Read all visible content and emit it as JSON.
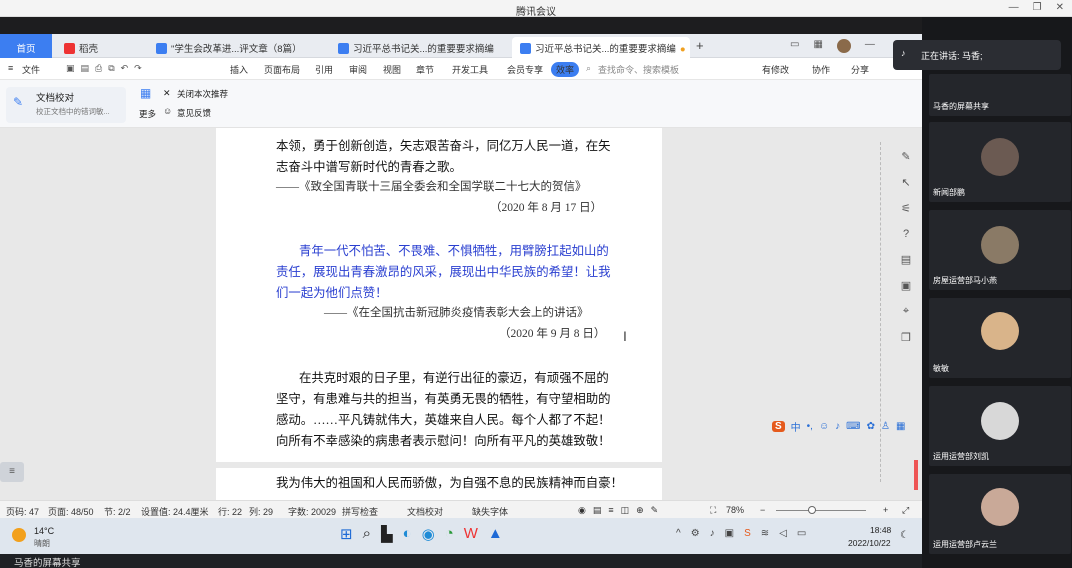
{
  "window": {
    "title": "腾讯会议"
  },
  "tabs": [
    {
      "label": "首页"
    },
    {
      "label": "稻壳"
    },
    {
      "label": "\"学生会改革进...评文章（8篇）"
    },
    {
      "label": "习近平总书记关...的重要要求摘编"
    },
    {
      "label": "习近平总书记关...的重要要求摘编"
    }
  ],
  "menu": {
    "file": "文件",
    "items": [
      "插入",
      "页面布局",
      "引用",
      "审阅",
      "视图",
      "章节",
      "开发工具",
      "会员专享"
    ],
    "active_pill": "效率",
    "search_placeholder": "查找命令、搜索模板",
    "revisions": "有修改",
    "collab": "协作",
    "share": "分享"
  },
  "ribbon": {
    "proof_title": "文档校对",
    "proof_sub": "校正文档中的错词敏...",
    "more": "更多",
    "close_recommend": "关闭本次推荐",
    "feedback": "意见反馈"
  },
  "document": {
    "p1_l1": "本领，勇于创新创造，矢志艰苦奋斗，同亿万人民一道，在矢",
    "p1_l2": "志奋斗中谱写新时代的青春之歌。",
    "p1_src": "——《致全国青联十三届全委会和全国学联二十七大的贺信》",
    "p1_date": "（2020 年 8 月 17 日）",
    "p2_l1": "青年一代不怕苦、不畏难、不惧牺牲，用臂膀扛起如山的",
    "p2_l2": "责任，展现出青春激昂的风采，展现出中华民族的希望！让我",
    "p2_l3": "们一起为他们点赞！",
    "p2_src": "——《在全国抗击新冠肺炎疫情表彰大会上的讲话》",
    "p2_date": "（2020 年 9 月 8 日）",
    "p3_l1": "在共克时艰的日子里，有逆行出征的豪迈，有顽强不屈的",
    "p3_l2": "坚守，有患难与共的担当，有英勇无畏的牺牲，有守望相助的",
    "p3_l3": "感动。……平凡铸就伟大，英雄来自人民。每个人都了不起！",
    "p3_l4": "向所有不幸感染的病患者表示慰问！向所有平凡的英雄致敬！",
    "p4_l1": "我为伟大的祖国和人民而骄傲，为自强不息的民族精神而自豪！"
  },
  "ime": {
    "lang": "中"
  },
  "status": {
    "page": "页码: 47",
    "pages": "页面: 48/50",
    "section": "节: 2/2",
    "setting": "设置值: 24.4厘米",
    "row": "行: 22",
    "col": "列: 29",
    "words": "字数: 20029",
    "spell": "拼写检查",
    "proof": "文档校对",
    "font_missing": "缺失字体",
    "zoom": "78%"
  },
  "taskbar": {
    "temp": "14°C",
    "weather": "晴朗",
    "time": "18:48",
    "date": "2022/10/22"
  },
  "share_banner": "马香的屏幕共享",
  "meeting": {
    "speaking": "正在讲话: 马香;",
    "participants": [
      {
        "name": "马香的屏幕共享"
      },
      {
        "name": "新闻部鹏"
      },
      {
        "name": "房屋运营部马小燕"
      },
      {
        "name": "敏敏"
      },
      {
        "name": "运用运营部刘凯"
      },
      {
        "name": "运用运营部卢云兰"
      }
    ]
  },
  "colors": {
    "accent": "#3c7ef1",
    "quote_blue": "#2a3fd0",
    "meeting_bg": "#17181b"
  }
}
